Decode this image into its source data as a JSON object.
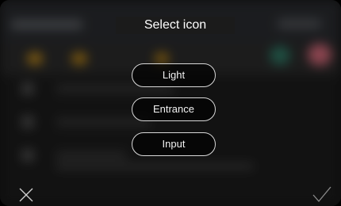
{
  "dialog": {
    "title": "Select icon",
    "options": [
      {
        "label": "Light"
      },
      {
        "label": "Entrance"
      },
      {
        "label": "Input"
      }
    ]
  },
  "controls": {
    "close_icon": "close-icon",
    "confirm_icon": "checkmark-icon"
  },
  "colors": {
    "accent_amber": "#c9901b",
    "accent_teal": "#2f7a66",
    "accent_pink": "#d66a7a",
    "button_border": "#d8d8d8",
    "text": "#ffffff"
  }
}
